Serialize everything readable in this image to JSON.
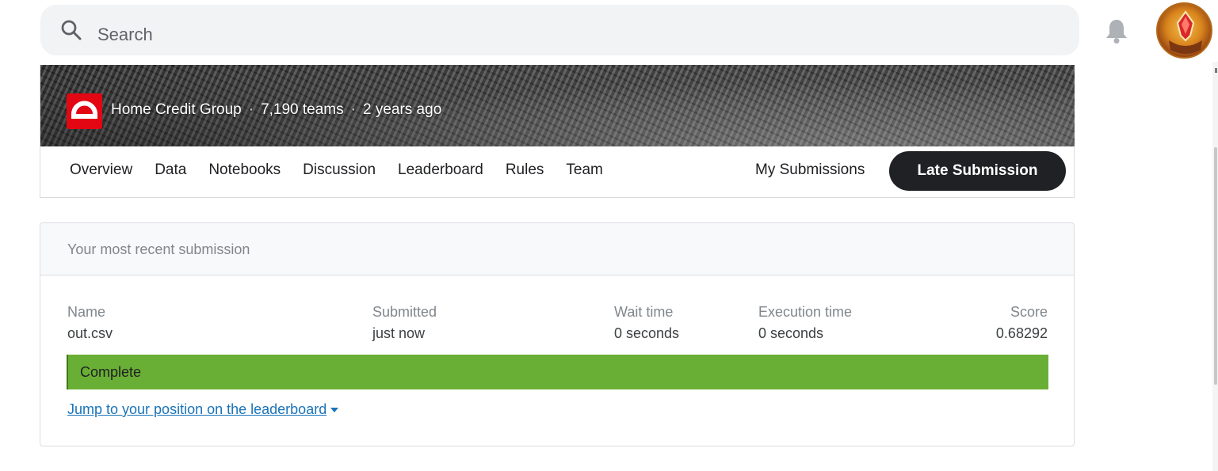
{
  "search": {
    "placeholder": "Search"
  },
  "icons": {
    "search": "search-icon",
    "bell": "bell-icon",
    "caret": "caret-down-icon"
  },
  "competition": {
    "host": "Home Credit Group",
    "separator": "·",
    "teams": "7,190 teams",
    "age": "2 years ago"
  },
  "tabs": [
    {
      "label": "Overview"
    },
    {
      "label": "Data"
    },
    {
      "label": "Notebooks"
    },
    {
      "label": "Discussion"
    },
    {
      "label": "Leaderboard"
    },
    {
      "label": "Rules"
    },
    {
      "label": "Team"
    }
  ],
  "actions": {
    "my_submissions": "My Submissions",
    "late_submission": "Late Submission"
  },
  "submission": {
    "title": "Your most recent submission",
    "columns": {
      "name": {
        "label": "Name",
        "value": "out.csv"
      },
      "submitted": {
        "label": "Submitted",
        "value": "just now"
      },
      "wait": {
        "label": "Wait time",
        "value": "0 seconds"
      },
      "execution": {
        "label": "Execution time",
        "value": "0 seconds"
      },
      "score": {
        "label": "Score",
        "value": "0.68292"
      }
    },
    "status": "Complete",
    "jump_link": "Jump to your position on the leaderboard"
  },
  "colors": {
    "status_green": "#6aaf35",
    "button_dark": "#202124",
    "link": "#1a73b8",
    "host_logo": "#e30613"
  }
}
